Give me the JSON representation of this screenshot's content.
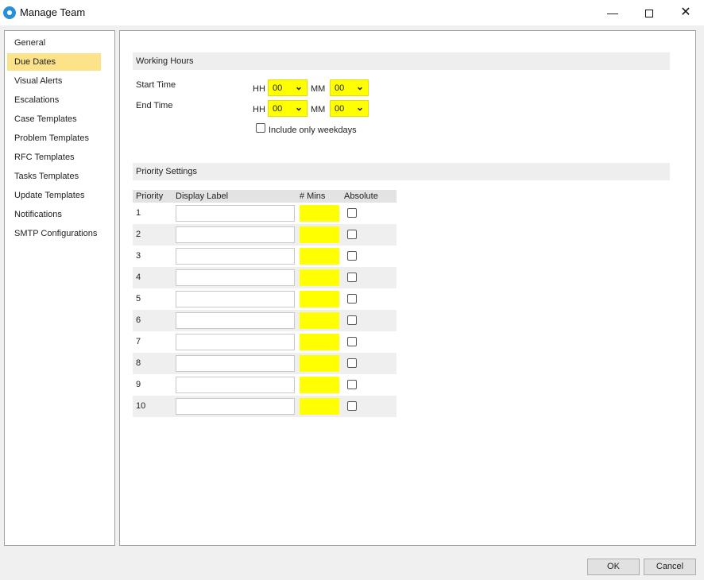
{
  "window": {
    "title": "Manage Team",
    "minimize": "—",
    "maximize": "",
    "close": "✕"
  },
  "sidebar": {
    "items": [
      {
        "label": "General"
      },
      {
        "label": "Due Dates",
        "active": true
      },
      {
        "label": "Visual Alerts"
      },
      {
        "label": "Escalations"
      },
      {
        "label": "Case Templates"
      },
      {
        "label": "Problem Templates"
      },
      {
        "label": "RFC Templates"
      },
      {
        "label": "Tasks Templates"
      },
      {
        "label": "Update Templates"
      },
      {
        "label": "Notifications"
      },
      {
        "label": "SMTP Configurations"
      }
    ]
  },
  "working_hours": {
    "header": "Working Hours",
    "start_label": "Start Time",
    "end_label": "End Time",
    "hh_label": "HH",
    "mm_label": "MM",
    "start_hh": "00",
    "start_mm": "00",
    "end_hh": "00",
    "end_mm": "00",
    "weekdays_label": "Include only weekdays",
    "weekdays_checked": false
  },
  "priority_settings": {
    "header": "Priority Settings",
    "columns": [
      "Priority",
      "Display Label",
      "# Mins",
      "Absolute"
    ],
    "rows": [
      {
        "priority": "1"
      },
      {
        "priority": "2"
      },
      {
        "priority": "3"
      },
      {
        "priority": "4"
      },
      {
        "priority": "5"
      },
      {
        "priority": "6"
      },
      {
        "priority": "7"
      },
      {
        "priority": "8"
      },
      {
        "priority": "9"
      },
      {
        "priority": "10"
      }
    ]
  },
  "footer": {
    "ok_label": "OK",
    "cancel_label": "Cancel"
  },
  "colors": {
    "highlight": "#ffff00",
    "active_nav": "#fce38a",
    "icon_blue": "#2a8fd8"
  }
}
